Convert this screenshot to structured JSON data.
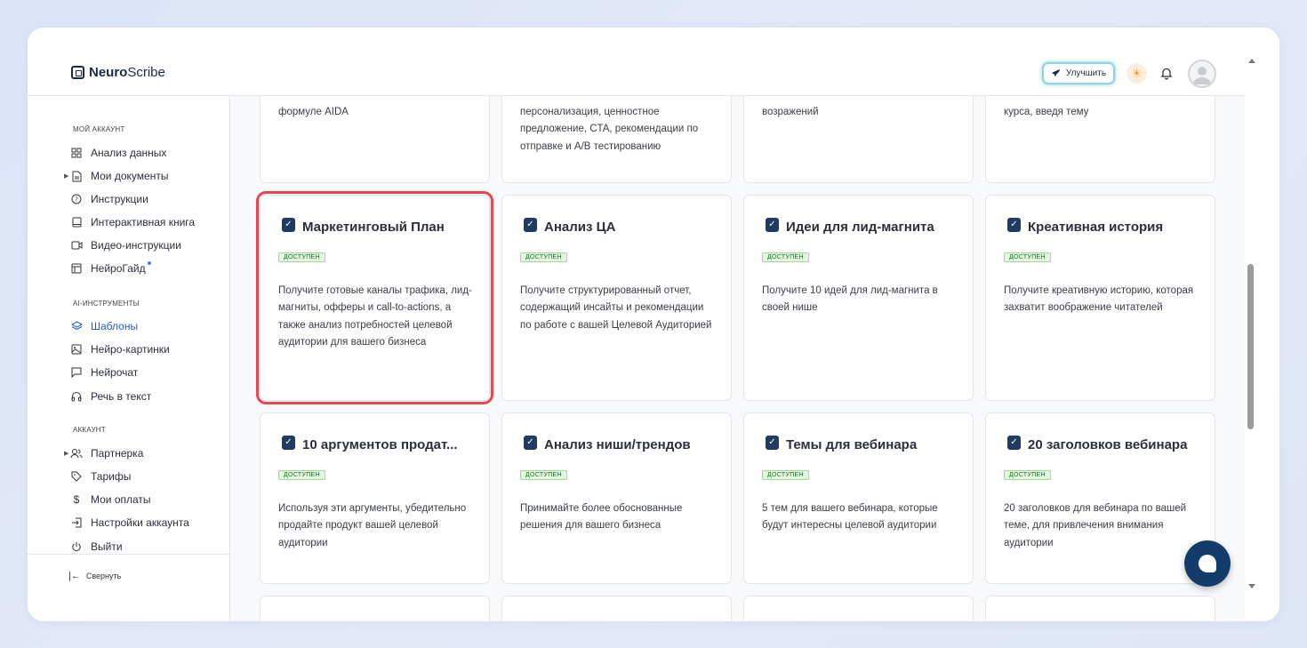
{
  "app": {
    "logo_bold": "Neuro",
    "logo_rest": "Scribe"
  },
  "header": {
    "upgrade_label": "Улучшить"
  },
  "sidebar": {
    "section_account": "МОЙ АККАУНТ",
    "account_items": [
      {
        "label": "Анализ данных",
        "icon": "grid-icon"
      },
      {
        "label": "Мои документы",
        "icon": "document-icon"
      },
      {
        "label": "Инструкции",
        "icon": "help-circle-icon"
      },
      {
        "label": "Интерактивная книга",
        "icon": "book-icon"
      },
      {
        "label": "Видео-инструкции",
        "icon": "video-icon"
      },
      {
        "label": "НейроГайд",
        "icon": "guide-icon"
      }
    ],
    "section_ai": "AI-ИНСТРУМЕНТЫ",
    "ai_items": [
      {
        "label": "Шаблоны",
        "icon": "layers-icon"
      },
      {
        "label": "Нейро-картинки",
        "icon": "image-icon"
      },
      {
        "label": "Нейрочат",
        "icon": "chat-icon"
      },
      {
        "label": "Речь в текст",
        "icon": "headphones-icon"
      }
    ],
    "section_profile": "АККАУНТ",
    "profile_items": [
      {
        "label": "Партнерка",
        "icon": "users-icon"
      },
      {
        "label": "Тарифы",
        "icon": "tag-icon"
      },
      {
        "label": "Мои оплаты",
        "icon": "dollar-icon"
      },
      {
        "label": "Настройки аккаунта",
        "icon": "login-icon"
      },
      {
        "label": "Выйти",
        "icon": "power-icon"
      }
    ],
    "collapse_label": "Свернуть"
  },
  "top_partial_cards": [
    {
      "desc": "формуле AIDA"
    },
    {
      "desc": "персонализация, ценностное предложение, CTA, рекомендации по отправке и A/B тестированию"
    },
    {
      "desc": "возражений"
    },
    {
      "desc": "курса, введя тему"
    }
  ],
  "cards_row1": [
    {
      "title": "Маркетинговый План",
      "badge": "ДОСТУПЕН",
      "desc": "Получите готовые каналы трафика, лид-магниты, офферы и call-to-actions, а также анализ потребностей целевой аудитории для вашего бизнеса"
    },
    {
      "title": "Анализ ЦА",
      "badge": "ДОСТУПЕН",
      "desc": "Получите структурированный отчет, содержащий инсайты и рекомендации по работе с вашей Целевой Аудиторией"
    },
    {
      "title": "Идеи для лид-магнита",
      "badge": "ДОСТУПЕН",
      "desc": "Получите 10 идей для лид-магнита в своей нише"
    },
    {
      "title": "Креативная история",
      "badge": "ДОСТУПЕН",
      "desc": "Получите креативную историю, которая захватит воображение читателей"
    }
  ],
  "cards_row2": [
    {
      "title": "10 аргументов продат...",
      "badge": "ДОСТУПЕН",
      "desc": "Используя эти аргументы, убедительно продайте продукт вашей целевой аудитории"
    },
    {
      "title": "Анализ ниши/трендов",
      "badge": "ДОСТУПЕН",
      "desc": "Принимайте более обоснованные решения для вашего бизнеса"
    },
    {
      "title": "Темы для вебинара",
      "badge": "ДОСТУПЕН",
      "desc": "5 тем для вашего вебинара, которые будут интересны целевой аудитории"
    },
    {
      "title": "20 заголовков вебинара",
      "badge": "ДОСТУПЕН",
      "desc": "20 заголовков для вебинара по вашей теме, для привлечения внимания аудитории"
    }
  ]
}
